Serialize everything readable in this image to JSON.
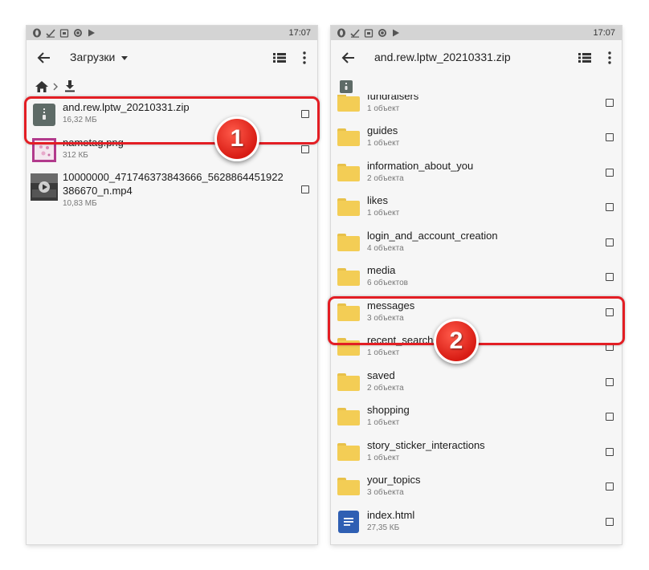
{
  "status_bar": {
    "time": "17:07"
  },
  "left_screen": {
    "toolbar": {
      "title": "Загрузки"
    },
    "files": [
      {
        "name": "and.rew.lptw_20210331.zip",
        "meta": "16,32 МБ",
        "icon": "zip-archive-icon"
      },
      {
        "name": "nametag.png",
        "meta": "312 КБ",
        "icon": "image-thumbnail"
      },
      {
        "name_line1": "10000000_471746373843666_5628864451922",
        "name_line2": "386670_n.mp4",
        "meta": "10,83 МБ",
        "icon": "video-thumbnail"
      }
    ]
  },
  "right_screen": {
    "toolbar": {
      "title": "and.rew.lptw_20210331.zip"
    },
    "folders": [
      {
        "name": "fundraisers",
        "meta": "1 объект"
      },
      {
        "name": "guides",
        "meta": "1 объект"
      },
      {
        "name": "information_about_you",
        "meta": "2 объекта"
      },
      {
        "name": "likes",
        "meta": "1 объект"
      },
      {
        "name": "login_and_account_creation",
        "meta": "4 объекта"
      },
      {
        "name": "media",
        "meta": "6 объектов"
      },
      {
        "name": "messages",
        "meta": "3 объекта"
      },
      {
        "name": "recent_searches",
        "meta": "1 объект"
      },
      {
        "name": "saved",
        "meta": "2 объекта"
      },
      {
        "name": "shopping",
        "meta": "1 объект"
      },
      {
        "name": "story_sticker_interactions",
        "meta": "1 объект"
      },
      {
        "name": "your_topics",
        "meta": "3 объекта"
      }
    ],
    "file": {
      "name": "index.html",
      "meta": "27,35 КБ"
    }
  },
  "callouts": {
    "step1": "1",
    "step2": "2"
  },
  "colors": {
    "highlight": "#e31e24",
    "folder": "#f3cd55",
    "html_file": "#2f5fb3"
  }
}
